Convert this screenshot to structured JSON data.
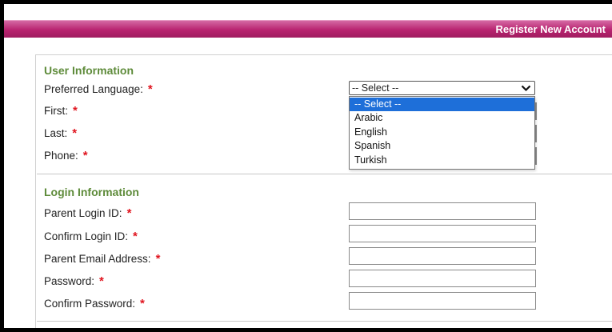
{
  "header": {
    "title": "Register New Account"
  },
  "user_info": {
    "section_title": "User Information",
    "fields": {
      "language": {
        "label": "Preferred Language:",
        "required": "*"
      },
      "first": {
        "label": "First:",
        "required": "*"
      },
      "last": {
        "label": "Last:",
        "required": "*"
      },
      "phone": {
        "label": "Phone:",
        "required": "*"
      }
    },
    "language_select": {
      "selected": "-- Select --",
      "options": [
        "-- Select --",
        "Arabic",
        "English",
        "Spanish",
        "Turkish"
      ]
    }
  },
  "login_info": {
    "section_title": "Login Information",
    "fields": {
      "login_id": {
        "label": "Parent Login ID:",
        "required": "*",
        "value": ""
      },
      "confirm_login_id": {
        "label": "Confirm Login ID:",
        "required": "*",
        "value": ""
      },
      "email": {
        "label": "Parent Email Address:",
        "required": "*",
        "value": ""
      },
      "password": {
        "label": "Password:",
        "required": "*",
        "value": ""
      },
      "confirm_password": {
        "label": "Confirm Password:",
        "required": "*",
        "value": ""
      }
    }
  },
  "colors": {
    "header_bar": "#b8236f",
    "section_title": "#5e8b3a",
    "required_marker": "#e0141e",
    "option_highlight": "#1e6fd9"
  }
}
